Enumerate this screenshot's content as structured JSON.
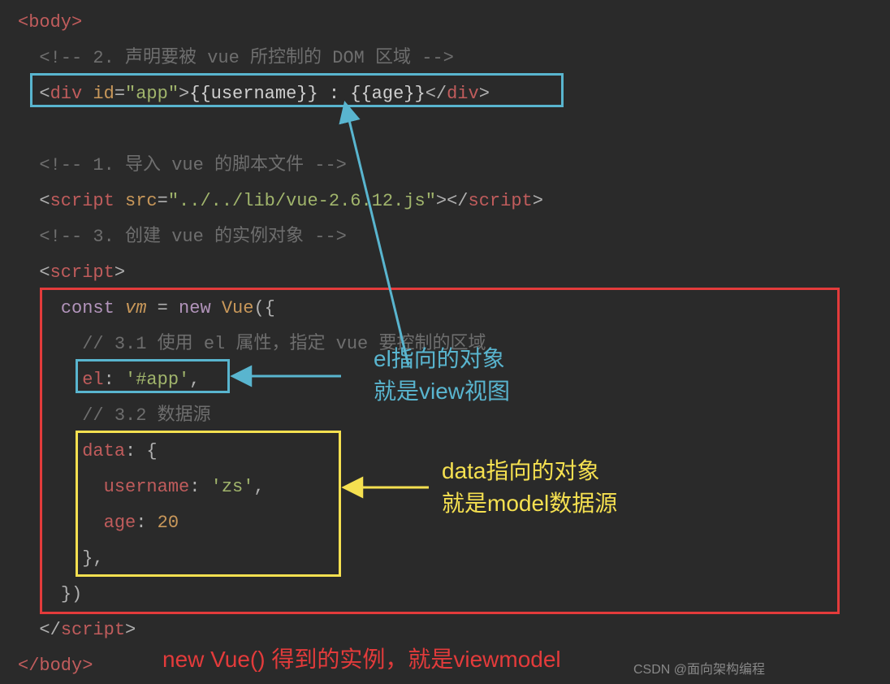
{
  "lines": {
    "l1": "<body>",
    "l2_a": "<!-- ",
    "l2_b": "2. 声明要被 vue 所控制的 DOM 区域",
    "l2_c": " -->",
    "l3_a": "<",
    "l3_b": "div",
    "l3_c": " id",
    "l3_d": "=",
    "l3_e": "\"app\"",
    "l3_f": ">",
    "l3_g": "{{username}} : {{age}}",
    "l3_h": "</",
    "l3_i": "div",
    "l3_j": ">",
    "l5_a": "<!-- ",
    "l5_b": "1. 导入 vue 的脚本文件",
    "l5_c": " -->",
    "l6_a": "<",
    "l6_b": "script",
    "l6_c": " src",
    "l6_d": "=",
    "l6_e": "\"../../lib/vue-2.6.12.js\"",
    "l6_f": "></",
    "l6_g": "script",
    "l6_h": ">",
    "l7_a": "<!-- ",
    "l7_b": "3. 创建 vue 的实例对象",
    "l7_c": " -->",
    "l8_a": "<",
    "l8_b": "script",
    "l8_c": ">",
    "l9_a": "const",
    "l9_b": " ",
    "l9_c": "vm",
    "l9_d": " = ",
    "l9_e": "new",
    "l9_f": " ",
    "l9_g": "Vue",
    "l9_h": "({",
    "l10_a": "// ",
    "l10_b": "3.1 使用 el 属性，指定 vue 要控制的区域",
    "l11_a": "el",
    "l11_b": ": ",
    "l11_c": "'#app'",
    "l11_d": ",",
    "l12_a": "// ",
    "l12_b": "3.2 数据源",
    "l13_a": "data",
    "l13_b": ": {",
    "l14_a": "username",
    "l14_b": ": ",
    "l14_c": "'zs'",
    "l14_d": ",",
    "l15_a": "age",
    "l15_b": ": ",
    "l15_c": "20",
    "l16": "},",
    "l17": "})",
    "l18_a": "</",
    "l18_b": "script",
    "l18_c": ">",
    "l19": "</body>"
  },
  "notes": {
    "cyan1": "el指向的对象",
    "cyan2": "就是view视图",
    "yellow1": "data指向的对象",
    "yellow2": "就是model数据源",
    "red1": "new Vue() 得到的实例，就是viewmodel"
  },
  "watermark": "CSDN @面向架构编程"
}
